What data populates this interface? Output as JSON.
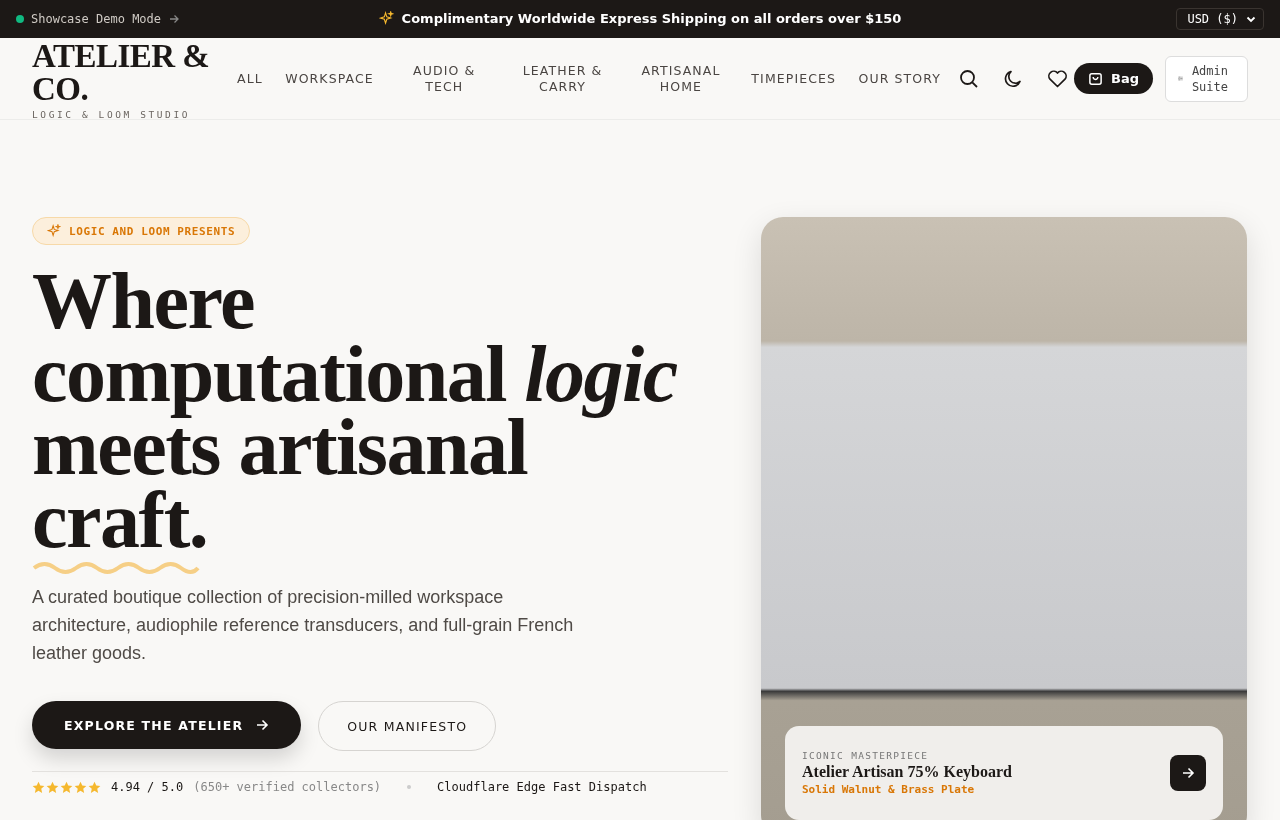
{
  "top_bar": {
    "demo_label": "Showcase Demo Mode",
    "announcement": "Complimentary Worldwide Express Shipping on all orders over $150",
    "currency": "USD ($)"
  },
  "header": {
    "logo": "ATELIER & CO.",
    "tagline": "LOGIC & LOOM STUDIO",
    "nav": [
      "ALL",
      "WORKSPACE",
      "AUDIO & TECH",
      "LEATHER & CARRY",
      "ARTISANAL HOME",
      "TIMEPIECES",
      "OUR STORY"
    ],
    "bag_button": "Bag",
    "admin_button": "Admin Suite"
  },
  "hero": {
    "badge": "LOGIC AND LOOM PRESENTS",
    "headline": "Where\ncomputational *logic*\nmeets artisanal\ncraft.",
    "description": "A curated boutique collection of precision-milled workspace architecture, audiophile reference transducers, and full-grain French leather goods.",
    "primary_button": "EXPLORE THE ATELIER",
    "secondary_button": "OUR MANIFESTO",
    "rating": {
      "stars": 5,
      "score": "4.94 / 5.0",
      "count": "(650+ verified collectors)"
    },
    "dispatch": "Cloudflare Edge Fast Dispatch"
  },
  "feature": {
    "eyebrow": "ICONIC MASTERPIECE",
    "title": "Atelier Artisan 75% Keyboard",
    "subtitle": "Solid Walnut & Brass Plate"
  }
}
